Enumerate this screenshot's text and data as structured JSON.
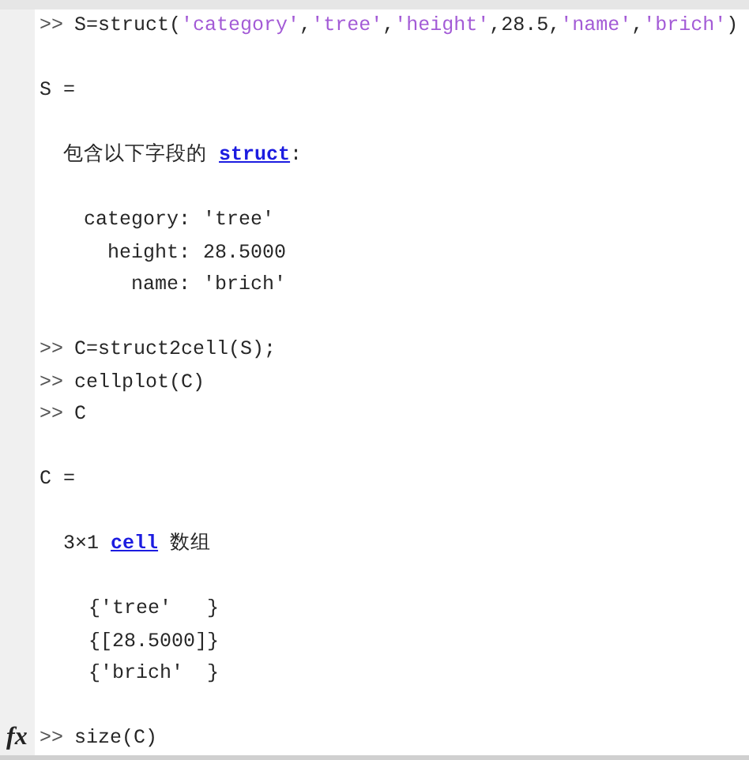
{
  "command_window": {
    "lines": [
      {
        "kind": "command",
        "prompt": ">>",
        "parts": [
          {
            "kind": "code",
            "text": "S=struct("
          },
          {
            "kind": "string",
            "text": "'category'"
          },
          {
            "kind": "code",
            "text": ","
          },
          {
            "kind": "string",
            "text": "'tree'"
          },
          {
            "kind": "code",
            "text": ","
          },
          {
            "kind": "string",
            "text": "'height'"
          },
          {
            "kind": "code",
            "text": ",28.5,"
          },
          {
            "kind": "string",
            "text": "'name'"
          },
          {
            "kind": "code",
            "text": ","
          },
          {
            "kind": "string",
            "text": "'brich'"
          },
          {
            "kind": "code",
            "text": ")"
          }
        ]
      },
      {
        "kind": "blank"
      },
      {
        "kind": "variable",
        "text": "S ="
      },
      {
        "kind": "blank"
      },
      {
        "kind": "summary",
        "before": "包含以下字段的",
        "link": "struct",
        "after": ":"
      },
      {
        "kind": "blank"
      },
      {
        "kind": "fields",
        "fields": [
          {
            "name": "category:",
            "value": "'tree'"
          },
          {
            "name": "height:",
            "value": "28.5000"
          },
          {
            "name": "name:",
            "value": "'brich'"
          }
        ]
      },
      {
        "kind": "blank"
      },
      {
        "kind": "command",
        "prompt": ">>",
        "parts": [
          {
            "kind": "code",
            "text": "C=struct2cell(S);"
          }
        ]
      },
      {
        "kind": "command",
        "prompt": ">>",
        "parts": [
          {
            "kind": "code",
            "text": "cellplot(C)"
          }
        ]
      },
      {
        "kind": "command",
        "prompt": ">>",
        "parts": [
          {
            "kind": "code",
            "text": "C"
          }
        ]
      },
      {
        "kind": "blank"
      },
      {
        "kind": "variable",
        "text": "C ="
      },
      {
        "kind": "blank"
      },
      {
        "kind": "summary",
        "before": "3×1",
        "link": "cell",
        "after": "数组"
      },
      {
        "kind": "blank"
      },
      {
        "kind": "cells",
        "cells": [
          "{'tree'   }",
          "{[28.5000]}",
          "{'brich'  }"
        ]
      },
      {
        "kind": "blank"
      },
      {
        "kind": "input",
        "prompt": ">>",
        "icon": "fx",
        "parts": [
          {
            "kind": "code",
            "text": "size(C)"
          }
        ]
      }
    ]
  }
}
